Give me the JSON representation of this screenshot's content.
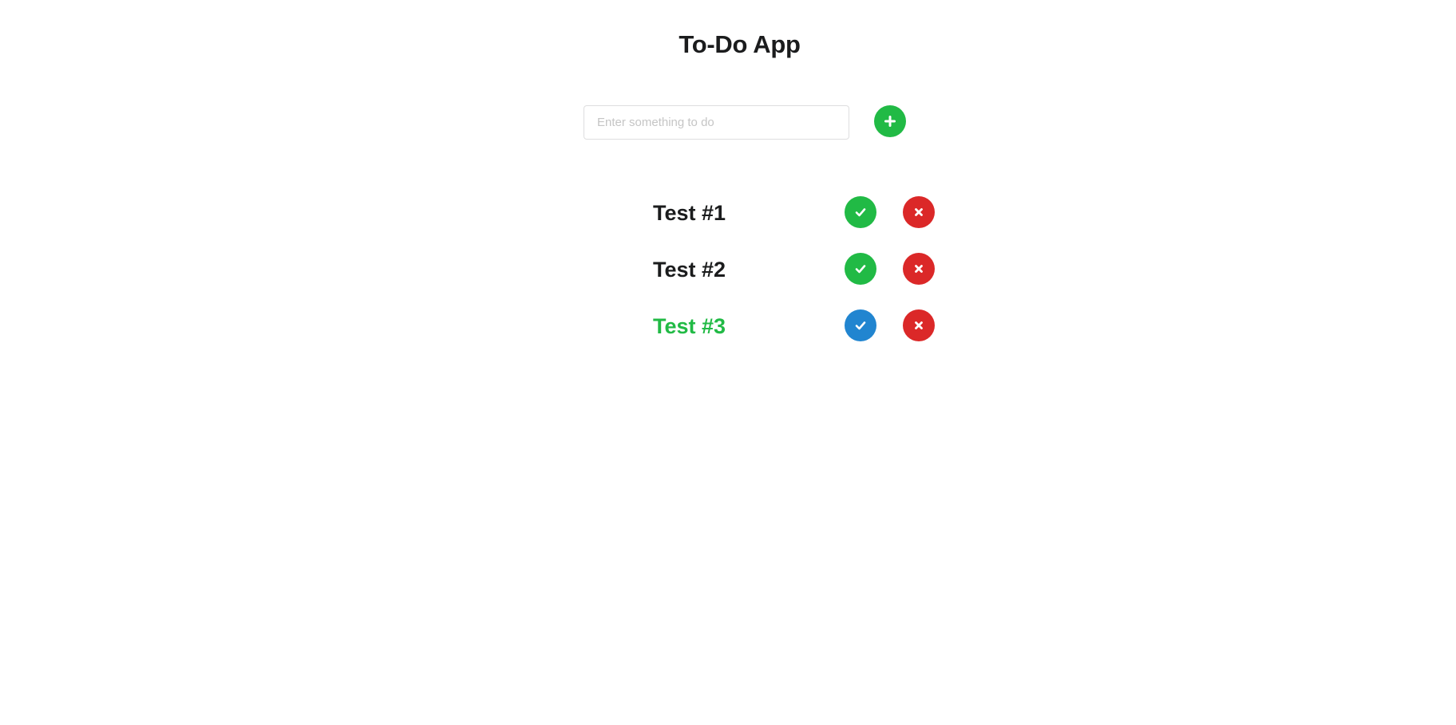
{
  "colors": {
    "green": "#21ba45",
    "red": "#db2828",
    "blue": "#2185d0",
    "text": "#1b1c1d"
  },
  "header": {
    "title": "To-Do App"
  },
  "new_todo": {
    "placeholder": "Enter something to do",
    "value": "",
    "add_icon": "plus-icon"
  },
  "todos": [
    {
      "text": "Test #1",
      "completed": false,
      "done_icon": "check-icon",
      "delete_icon": "times-icon"
    },
    {
      "text": "Test #2",
      "completed": false,
      "done_icon": "check-icon",
      "delete_icon": "times-icon"
    },
    {
      "text": "Test #3",
      "completed": true,
      "done_icon": "check-icon",
      "delete_icon": "times-icon"
    }
  ]
}
